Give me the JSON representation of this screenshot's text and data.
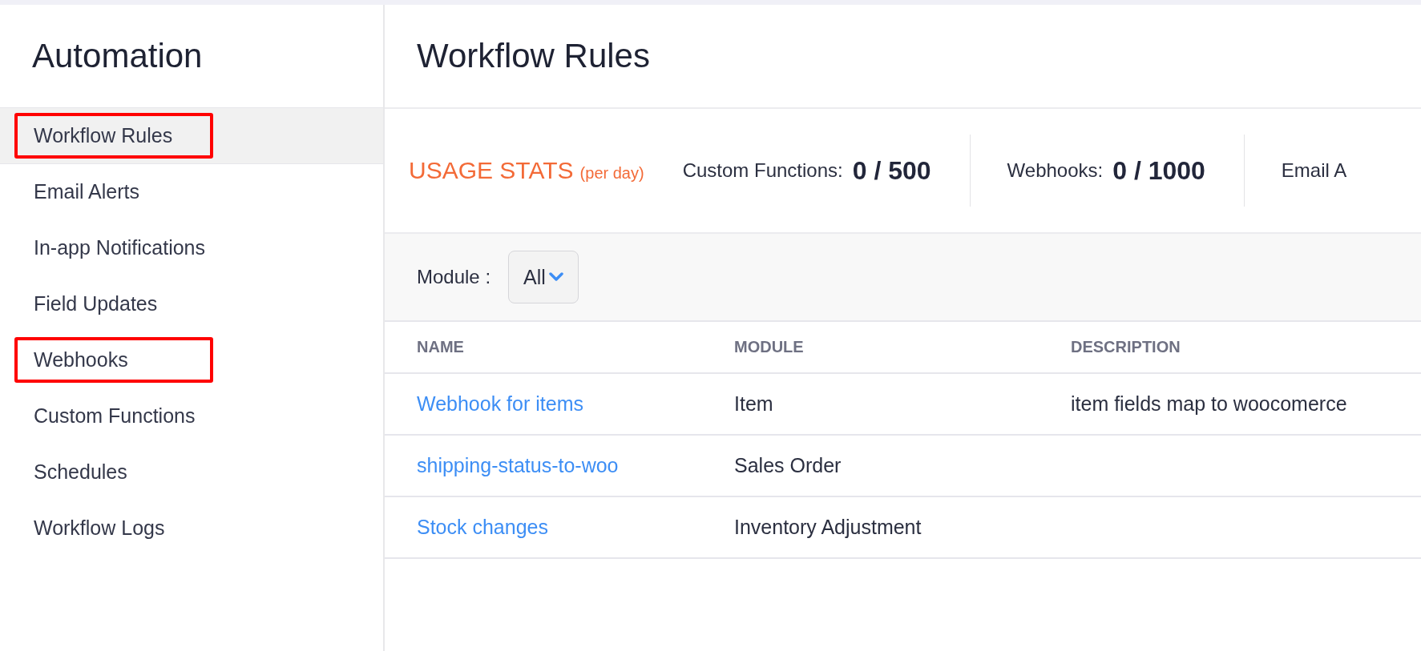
{
  "sidebar": {
    "title": "Automation",
    "items": [
      {
        "label": "Workflow Rules",
        "selected": true,
        "highlighted": true
      },
      {
        "label": "Email Alerts",
        "selected": false,
        "highlighted": false
      },
      {
        "label": "In-app Notifications",
        "selected": false,
        "highlighted": false
      },
      {
        "label": "Field Updates",
        "selected": false,
        "highlighted": false
      },
      {
        "label": "Webhooks",
        "selected": false,
        "highlighted": true
      },
      {
        "label": "Custom Functions",
        "selected": false,
        "highlighted": false
      },
      {
        "label": "Schedules",
        "selected": false,
        "highlighted": false
      },
      {
        "label": "Workflow Logs",
        "selected": false,
        "highlighted": false
      }
    ]
  },
  "main": {
    "title": "Workflow Rules",
    "usage_stats": {
      "heading": "USAGE STATS",
      "note": "(per day)",
      "stats": [
        {
          "label": "Custom Functions:",
          "value": "0 / 500"
        },
        {
          "label": "Webhooks:",
          "value": "0 / 1000"
        },
        {
          "label": "Email A"
        }
      ]
    },
    "filter": {
      "label": "Module :",
      "value": "All"
    },
    "table": {
      "columns": [
        "NAME",
        "MODULE",
        "DESCRIPTION"
      ],
      "rows": [
        {
          "name": "Webhook for items",
          "module": "Item",
          "description": "item fields map to woocomerce"
        },
        {
          "name": "shipping-status-to-woo",
          "module": "Sales Order"
        },
        {
          "name": "Stock changes",
          "module": "Inventory Adjustment"
        }
      ]
    }
  }
}
